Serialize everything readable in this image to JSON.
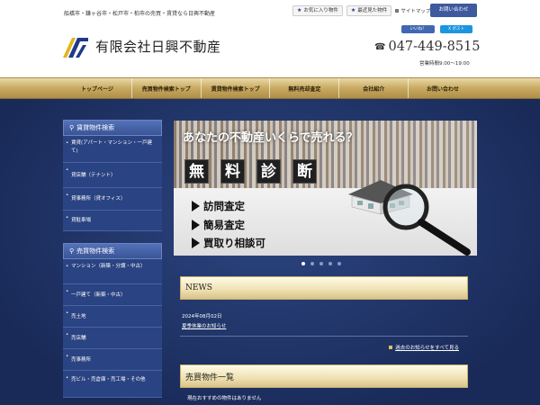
{
  "header": {
    "tagline": "船橋市・鎌ヶ谷市・松戸市・柏市の売買・賃貸なら日興不動産",
    "favorites_label": "お気に入り物件",
    "recent_label": "最近見た物件",
    "sitemap_label": "サイトマップ",
    "contact_label": "お問い合わせ",
    "company_name": "有限会社日興不動産",
    "facebook_label": "いいね！",
    "twitter_label": "X ポスト",
    "phone": "047-449-8515",
    "hours": "営業時間9:00～19:00"
  },
  "nav": {
    "items": [
      {
        "label": "トップページ"
      },
      {
        "label": "売買物件検索トップ"
      },
      {
        "label": "賃貸物件検索トップ"
      },
      {
        "label": "無料売却査定"
      },
      {
        "label": "会社紹介"
      },
      {
        "label": "お問い合わせ"
      }
    ]
  },
  "sidebar": {
    "rental": {
      "title": "賃貸物件検索",
      "items": [
        {
          "label": "賃貸(アパート・マンション・一戸建て)"
        },
        {
          "label": "貸店舗（テナント）"
        },
        {
          "label": "貸事務所（貸オフィス）"
        },
        {
          "label": "貸駐車場"
        }
      ]
    },
    "sale": {
      "title": "売買物件検索",
      "items": [
        {
          "label": "マンション（新築・分譲・中古）"
        },
        {
          "label": "一戸建て（新築・中古）"
        },
        {
          "label": "売土地"
        },
        {
          "label": "売店舗"
        },
        {
          "label": "売事務所"
        },
        {
          "label": "売ビル・売倉庫・売工場・その他"
        }
      ]
    }
  },
  "banner": {
    "headline": "あなたの不動産いくらで売れる？",
    "diagnosis_chars": [
      "無",
      "料",
      "診",
      "断"
    ],
    "bullets": [
      "訪問査定",
      "簡易査定",
      "買取り相談可"
    ],
    "slide_count": 5,
    "active_slide": 1
  },
  "news": {
    "title": "NEWS",
    "date": "2024年08月02日",
    "link": "夏季休業のお知らせ",
    "more_label": "過去のお知らせをすべて見る"
  },
  "listings": {
    "title": "売買物件一覧",
    "intro": "現在おすすめの物件はありません"
  },
  "colors": {
    "navy_bg": "#1e3263",
    "nav_gold": "#c8aa60",
    "contact_blue": "#3d5a9e"
  }
}
